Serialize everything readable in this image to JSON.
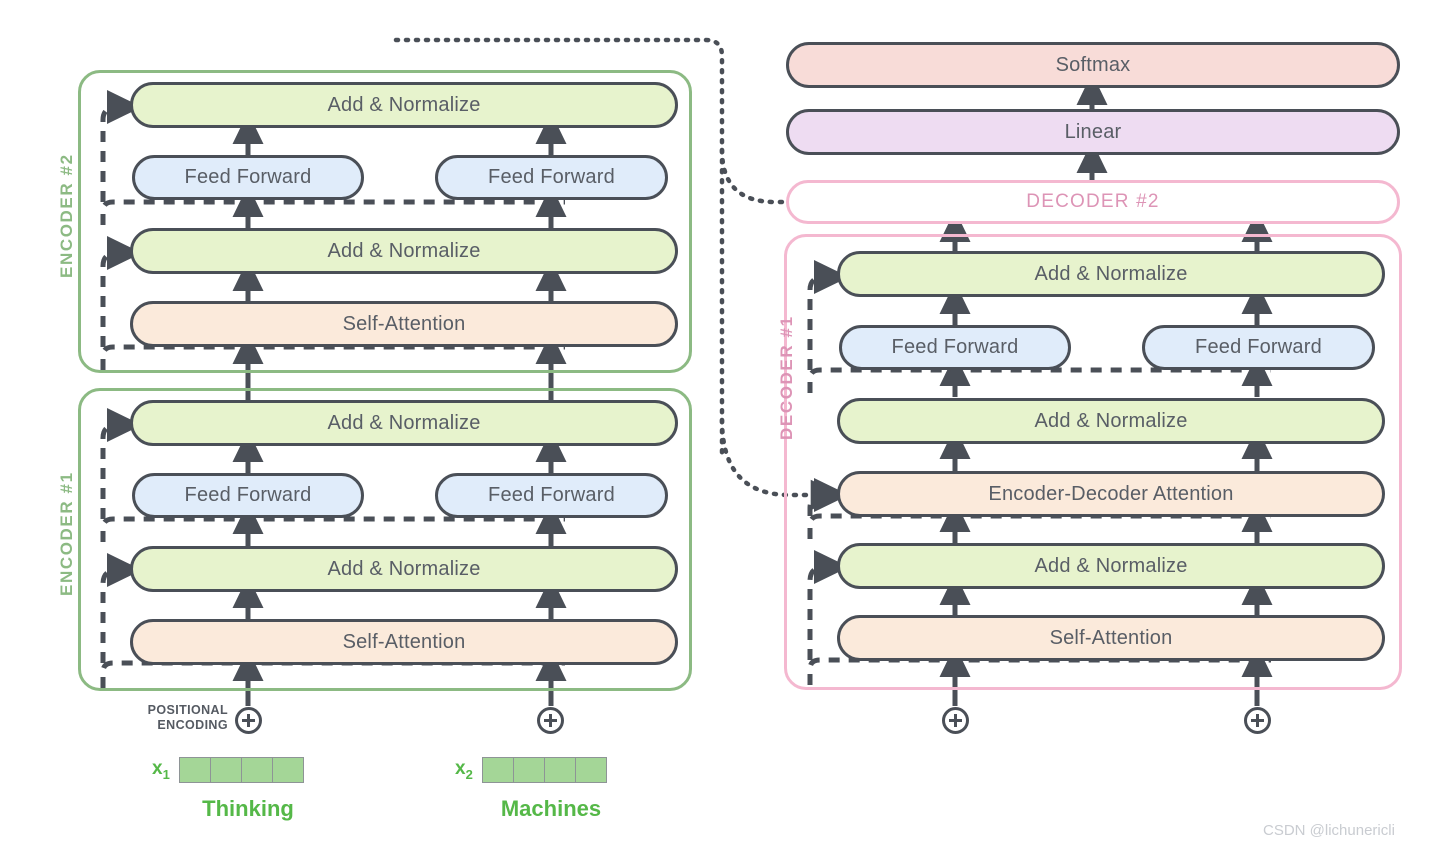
{
  "diagram": {
    "title": "Transformer encoder-decoder architecture",
    "colors": {
      "encoder_border": "#8cba83",
      "decoder_border": "#f4b8d0",
      "add_normalize_fill": "#e7f3cd",
      "attention_fill": "#fbeadb",
      "feed_forward_fill": "#e0ecfa",
      "softmax_fill": "#f8dcd8",
      "linear_fill": "#eedcf2",
      "outline": "#4a4f57",
      "token_green": "#55b848",
      "embedding_cell": "#a4d697"
    }
  },
  "encoder_stack": {
    "blocks": [
      {
        "label": "ENCODER #2",
        "sublayers": [
          {
            "name": "add-normalize-top",
            "label": "Add & Normalize",
            "kind": "addnorm"
          },
          {
            "name": "feed-forward-left",
            "label": "Feed Forward",
            "kind": "ff"
          },
          {
            "name": "feed-forward-right",
            "label": "Feed Forward",
            "kind": "ff"
          },
          {
            "name": "add-normalize-bottom",
            "label": "Add & Normalize",
            "kind": "addnorm"
          },
          {
            "name": "self-attention",
            "label": "Self-Attention",
            "kind": "attn"
          }
        ]
      },
      {
        "label": "ENCODER #1",
        "sublayers": [
          {
            "name": "add-normalize-top",
            "label": "Add & Normalize",
            "kind": "addnorm"
          },
          {
            "name": "feed-forward-left",
            "label": "Feed Forward",
            "kind": "ff"
          },
          {
            "name": "feed-forward-right",
            "label": "Feed Forward",
            "kind": "ff"
          },
          {
            "name": "add-normalize-bottom",
            "label": "Add & Normalize",
            "kind": "addnorm"
          },
          {
            "name": "self-attention",
            "label": "Self-Attention",
            "kind": "attn"
          }
        ]
      }
    ]
  },
  "decoder_stack": {
    "decoder2_label": "DECODER #2",
    "decoder1_label": "DECODER #1",
    "output_layers": [
      {
        "name": "softmax",
        "label": "Softmax",
        "kind": "softmax"
      },
      {
        "name": "linear",
        "label": "Linear",
        "kind": "linear"
      }
    ],
    "decoder1_sublayers": [
      {
        "name": "add-normalize-top",
        "label": "Add & Normalize",
        "kind": "addnorm"
      },
      {
        "name": "feed-forward-left",
        "label": "Feed Forward",
        "kind": "ff"
      },
      {
        "name": "feed-forward-right",
        "label": "Feed Forward",
        "kind": "ff"
      },
      {
        "name": "add-normalize-middle",
        "label": "Add & Normalize",
        "kind": "addnorm"
      },
      {
        "name": "encoder-decoder-attention",
        "label": "Encoder-Decoder Attention",
        "kind": "attn"
      },
      {
        "name": "add-normalize-bottom",
        "label": "Add & Normalize",
        "kind": "addnorm"
      },
      {
        "name": "self-attention",
        "label": "Self-Attention",
        "kind": "attn"
      }
    ]
  },
  "inputs": {
    "positional_encoding_line1": "POSITIONAL",
    "positional_encoding_line2": "ENCODING",
    "plus_symbol": "+",
    "tokens": [
      {
        "tag": "x",
        "index": "1",
        "word": "Thinking",
        "cells": 4
      },
      {
        "tag": "x",
        "index": "2",
        "word": "Machines",
        "cells": 4
      }
    ]
  },
  "watermark": {
    "text": "CSDN @lichunericli"
  }
}
